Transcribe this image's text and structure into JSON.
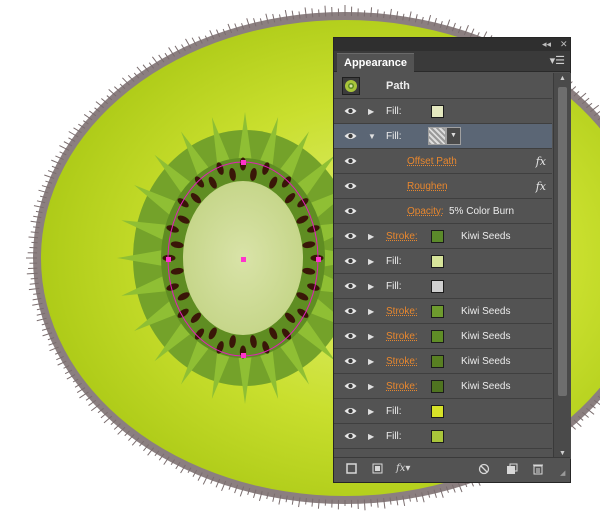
{
  "panel": {
    "tab_label": "Appearance",
    "collapse_icon": "double-chevron-icon",
    "close_icon": "close-icon",
    "menu_icon": "panel-menu-icon",
    "header_title": "Path",
    "rows": [
      {
        "label": "Fill:",
        "swatch": "#e4e8bf",
        "value": "",
        "link": false,
        "fx": false,
        "triangle": "right",
        "eye": true,
        "selected": false
      },
      {
        "label": "Fill:",
        "swatch": "pattern",
        "value": "",
        "link": false,
        "fx": false,
        "triangle": "down",
        "eye": true,
        "selected": true
      },
      {
        "label": "Offset Path",
        "swatch": "",
        "value": "",
        "link": true,
        "fx": true,
        "triangle": "",
        "eye": true,
        "selected": false
      },
      {
        "label": "Roughen",
        "swatch": "",
        "value": "",
        "link": true,
        "fx": true,
        "triangle": "",
        "eye": true,
        "selected": false
      },
      {
        "label": "Opacity:",
        "swatch": "",
        "value": "5% Color Burn",
        "link": true,
        "fx": false,
        "triangle": "",
        "eye": true,
        "selected": false
      },
      {
        "label": "Stroke:",
        "swatch": "#5b8a2a",
        "value": "Kiwi Seeds",
        "link": true,
        "fx": false,
        "triangle": "right",
        "eye": true,
        "selected": false
      },
      {
        "label": "Fill:",
        "swatch": "#d7e49a",
        "value": "",
        "link": false,
        "fx": false,
        "triangle": "right",
        "eye": true,
        "selected": false
      },
      {
        "label": "Fill:",
        "swatch": "#cfcfcf",
        "value": "",
        "link": false,
        "fx": false,
        "triangle": "right",
        "eye": true,
        "selected": false
      },
      {
        "label": "Stroke:",
        "swatch": "#6e9b2e",
        "value": "Kiwi Seeds",
        "link": true,
        "fx": false,
        "triangle": "right",
        "eye": true,
        "selected": false
      },
      {
        "label": "Stroke:",
        "swatch": "#5f8d26",
        "value": "Kiwi Seeds",
        "link": true,
        "fx": false,
        "triangle": "right",
        "eye": true,
        "selected": false
      },
      {
        "label": "Stroke:",
        "swatch": "#587f22",
        "value": "Kiwi Seeds",
        "link": true,
        "fx": false,
        "triangle": "right",
        "eye": true,
        "selected": false
      },
      {
        "label": "Stroke:",
        "swatch": "#4f7420",
        "value": "Kiwi Seeds",
        "link": true,
        "fx": false,
        "triangle": "right",
        "eye": true,
        "selected": false
      },
      {
        "label": "Fill:",
        "swatch": "#d7e228",
        "value": "",
        "link": false,
        "fx": false,
        "triangle": "right",
        "eye": true,
        "selected": false
      },
      {
        "label": "Fill:",
        "swatch": "#a9c53a",
        "value": "",
        "link": false,
        "fx": false,
        "triangle": "right",
        "eye": true,
        "selected": false
      }
    ],
    "bottom_icons": [
      "new-stroke-icon",
      "new-fill-icon",
      "fx-icon",
      "clear-appearance-icon",
      "duplicate-item-icon",
      "delete-icon"
    ],
    "fx_label": "fx"
  },
  "colors": {
    "panel_bg": "#535353",
    "selection": "#5b6675",
    "link_text": "#e8872e",
    "anchor": "#ff33cc"
  }
}
